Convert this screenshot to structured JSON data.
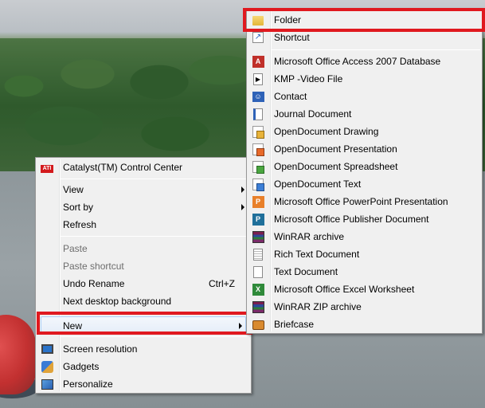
{
  "context_menu": {
    "items": [
      {
        "label": "Catalyst(TM) Control Center",
        "icon": "ati-icon"
      },
      {
        "label": "View"
      },
      {
        "label": "Sort by"
      },
      {
        "label": "Refresh"
      },
      {
        "label": "Paste"
      },
      {
        "label": "Paste shortcut"
      },
      {
        "label": "Undo Rename",
        "shortcut": "Ctrl+Z"
      },
      {
        "label": "Next desktop background"
      },
      {
        "label": "New"
      },
      {
        "label": "Screen resolution",
        "icon": "monitor-icon"
      },
      {
        "label": "Gadgets",
        "icon": "gadgets-icon"
      },
      {
        "label": "Personalize",
        "icon": "personalize-icon"
      }
    ]
  },
  "new_submenu": {
    "items": [
      {
        "label": "Folder",
        "icon": "folder-icon"
      },
      {
        "label": "Shortcut",
        "icon": "shortcut-icon"
      },
      {
        "label": "Microsoft Office Access 2007 Database",
        "icon": "access-icon",
        "glyph": "A"
      },
      {
        "label": "KMP -Video File",
        "icon": "video-file-icon",
        "glyph": "▶"
      },
      {
        "label": "Contact",
        "icon": "contact-icon",
        "glyph": "☺"
      },
      {
        "label": "Journal Document",
        "icon": "journal-icon"
      },
      {
        "label": "OpenDocument Drawing",
        "icon": "odg-icon"
      },
      {
        "label": "OpenDocument Presentation",
        "icon": "odp-icon"
      },
      {
        "label": "OpenDocument Spreadsheet",
        "icon": "ods-icon"
      },
      {
        "label": "OpenDocument Text",
        "icon": "odt-icon"
      },
      {
        "label": "Microsoft Office PowerPoint Presentation",
        "icon": "powerpoint-icon",
        "glyph": "P"
      },
      {
        "label": "Microsoft Office Publisher Document",
        "icon": "publisher-icon",
        "glyph": "P"
      },
      {
        "label": "WinRAR archive",
        "icon": "winrar-icon"
      },
      {
        "label": "Rich Text Document",
        "icon": "rtf-icon"
      },
      {
        "label": "Text Document",
        "icon": "text-doc-icon"
      },
      {
        "label": "Microsoft Office Excel Worksheet",
        "icon": "excel-icon",
        "glyph": "X"
      },
      {
        "label": "WinRAR ZIP archive",
        "icon": "winrar-zip-icon"
      },
      {
        "label": "Briefcase",
        "icon": "briefcase-icon"
      }
    ]
  },
  "ati_glyph": "ATI",
  "shortcut_glyph": "↗",
  "colors": {
    "highlight_box": "#e0191f"
  }
}
